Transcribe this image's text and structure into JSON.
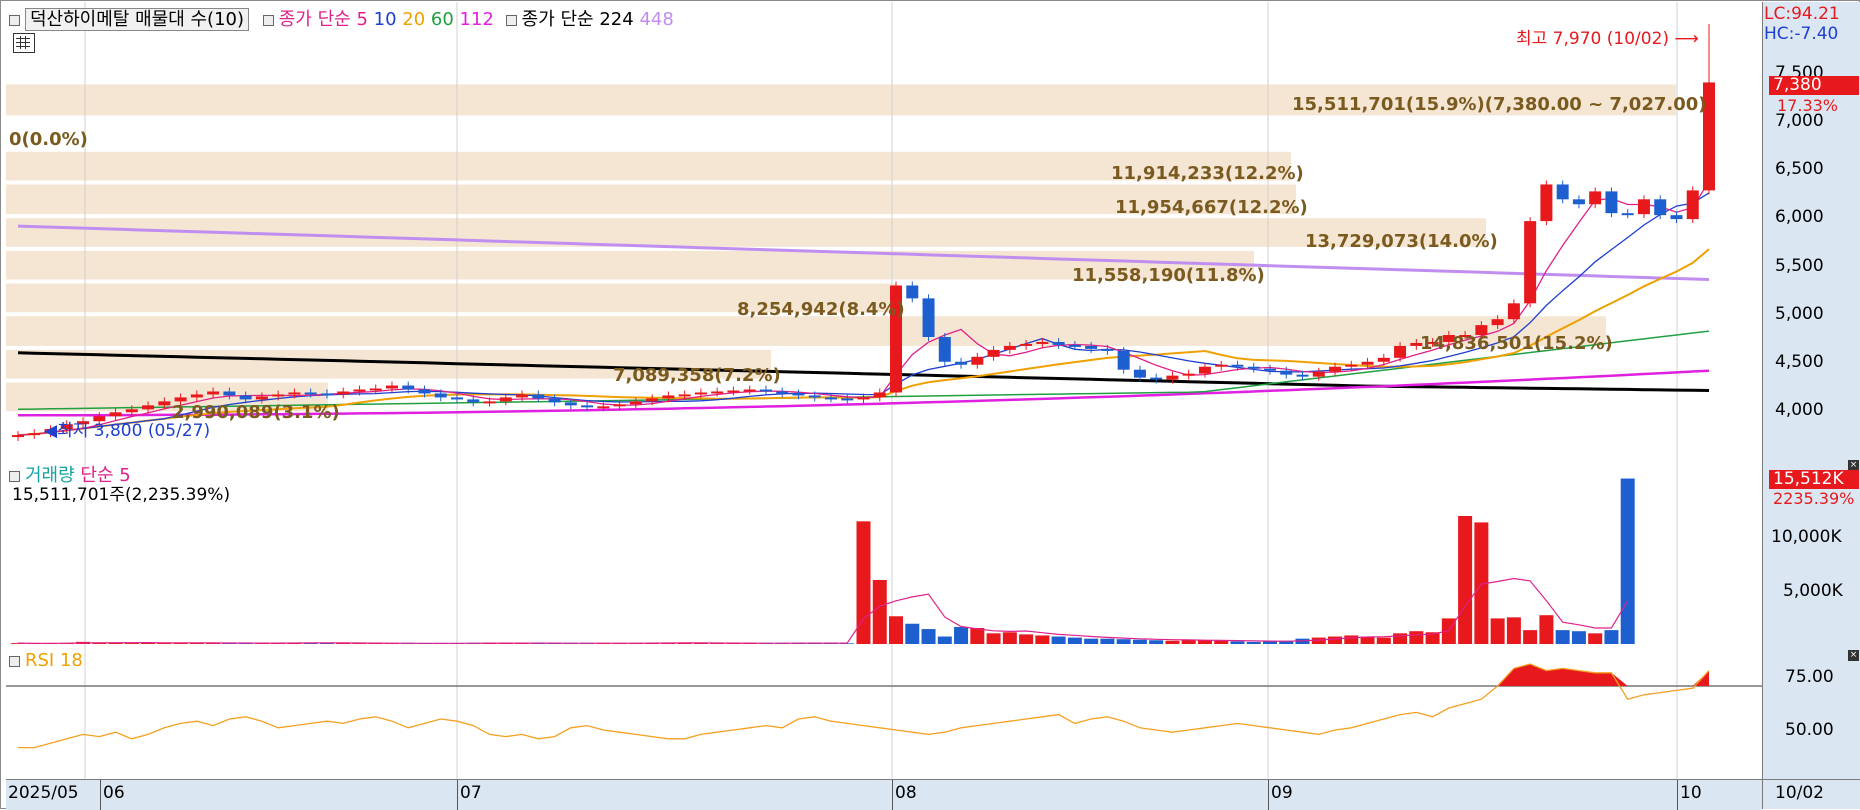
{
  "header": {
    "stock_title": "덕산하이메탈 매물대 수(10)",
    "ma_group1_label": "종가 단순",
    "ma_group1_periods": [
      "5",
      "10",
      "20",
      "60",
      "112"
    ],
    "ma_group2_label": "종가 단순",
    "ma_group2_periods": [
      "224",
      "448"
    ]
  },
  "price_pane": {
    "high_label": "최고 7,970 (10/02)",
    "low_label": "최저 3,800 (05/27)",
    "lc_label": "LC:94.21",
    "hc_label": "HC:-7.40",
    "current_price": "7,380",
    "current_change": "17.33%",
    "y_ticks": [
      "7,500",
      "7,000",
      "6,500",
      "6,000",
      "5,500",
      "5,000",
      "4,500",
      "4,000"
    ],
    "volume_profile": [
      {
        "label": "15,511,701(15.9%)(7,380.00 ~ 7,027.00)"
      },
      {
        "label": "0(0.0%)"
      },
      {
        "label": "11,914,233(12.2%)"
      },
      {
        "label": "11,954,667(12.2%)"
      },
      {
        "label": "13,729,073(14.0%)"
      },
      {
        "label": "11,558,190(11.8%)"
      },
      {
        "label": "8,254,942(8.4%)"
      },
      {
        "label": "14,836,501(15.2%)"
      },
      {
        "label": "7,089,358(7.2%)"
      },
      {
        "label": "2,990,089(3.1%)"
      }
    ]
  },
  "volume_pane": {
    "label": "거래량",
    "ma_label": "단순 5",
    "info": "15,511,701주(2,235.39%)",
    "current_value": "15,512K",
    "current_change": "2235.39%",
    "y_ticks": [
      "10,000K",
      "5,000K"
    ]
  },
  "rsi_pane": {
    "label": "RSI 18",
    "y_ticks": [
      "75.00",
      "50.00"
    ]
  },
  "time_axis": {
    "labels": [
      "2025/05",
      "06",
      "07",
      "08",
      "09",
      "10"
    ],
    "right_label": "10/02"
  },
  "colors": {
    "up": "#e8191c",
    "down": "#1e5fd0",
    "ma5": "#e0218a",
    "ma10": "#1e3fd0",
    "ma20": "#f0a000",
    "ma60": "#20a040",
    "ma112": "#e020e0",
    "ma224": "#000000",
    "ma448": "#c08ef0",
    "band": "#f5e6d3",
    "rsi": "#f5a020"
  },
  "chart_data": [
    {
      "type": "candlestick",
      "title": "덕산하이메탈",
      "ylim": [
        3750,
        7990
      ],
      "x_range": [
        "2025/05",
        "10/02"
      ],
      "high": {
        "value": 7970,
        "date": "10/02"
      },
      "low": {
        "value": 3800,
        "date": "05/27"
      },
      "last_close": 7380,
      "last_change_pct": 17.33,
      "closes": [
        3820,
        3840,
        3880,
        3930,
        3960,
        4010,
        4050,
        4080,
        4120,
        4160,
        4200,
        4230,
        4260,
        4220,
        4180,
        4210,
        4230,
        4250,
        4240,
        4230,
        4260,
        4280,
        4290,
        4320,
        4280,
        4240,
        4200,
        4180,
        4150,
        4160,
        4200,
        4230,
        4190,
        4150,
        4120,
        4100,
        4110,
        4130,
        4160,
        4190,
        4220,
        4230,
        4250,
        4260,
        4270,
        4280,
        4260,
        4240,
        4220,
        4200,
        4190,
        4180,
        4200,
        4250,
        5330,
        5200,
        4810,
        4560,
        4530,
        4610,
        4680,
        4720,
        4740,
        4760,
        4730,
        4720,
        4690,
        4670,
        4480,
        4400,
        4380,
        4420,
        4440,
        4510,
        4530,
        4510,
        4490,
        4470,
        4430,
        4410,
        4460,
        4510,
        4530,
        4560,
        4600,
        4720,
        4750,
        4760,
        4830,
        4830,
        4930,
        4990,
        5150,
        5980,
        6350,
        6200,
        6150,
        6280,
        6060,
        6050,
        6200,
        6040,
        6000,
        6290,
        7380
      ],
      "ma_series": [
        {
          "name": "5",
          "period": 5
        },
        {
          "name": "10",
          "period": 10
        },
        {
          "name": "20",
          "period": 20
        },
        {
          "name": "60",
          "period": 60
        },
        {
          "name": "112",
          "period": 112
        },
        {
          "name": "224",
          "period": 224
        },
        {
          "name": "448",
          "period": 448
        }
      ]
    },
    {
      "type": "bar",
      "title": "거래량",
      "ylim": [
        0,
        16500
      ],
      "unit": "K",
      "values": [
        80,
        60,
        70,
        90,
        200,
        150,
        100,
        90,
        110,
        120,
        130,
        90,
        80,
        70,
        80,
        90,
        100,
        110,
        120,
        90,
        80,
        70,
        80,
        60,
        70,
        60,
        60,
        80,
        100,
        110,
        80,
        70,
        60,
        80,
        90,
        60,
        70,
        80,
        90,
        100,
        110,
        120,
        80,
        70,
        60,
        70,
        80,
        100,
        90,
        80,
        70,
        60,
        11500,
        6000,
        2600,
        1900,
        1400,
        700,
        1600,
        1500,
        1000,
        1100,
        900,
        800,
        700,
        600,
        500,
        500,
        450,
        400,
        350,
        300,
        400,
        350,
        300,
        250,
        200,
        250,
        300,
        500,
        600,
        700,
        800,
        700,
        600,
        1000,
        1200,
        1100,
        2400,
        12000,
        11400,
        2400,
        2500,
        1300,
        2700,
        1300,
        1200,
        1000,
        1300,
        15512
      ]
    },
    {
      "type": "line",
      "title": "RSI 18",
      "ylim": [
        30,
        85
      ],
      "reference": 70,
      "values": [
        42,
        42,
        44,
        46,
        48,
        47,
        49,
        46,
        48,
        51,
        53,
        54,
        52,
        55,
        56,
        54,
        51,
        52,
        53,
        54,
        53,
        55,
        56,
        54,
        51,
        53,
        55,
        54,
        52,
        48,
        47,
        48,
        46,
        47,
        51,
        52,
        50,
        49,
        48,
        47,
        46,
        46,
        48,
        49,
        50,
        51,
        52,
        51,
        55,
        56,
        54,
        53,
        52,
        51,
        50,
        49,
        48,
        49,
        51,
        52,
        53,
        54,
        55,
        56,
        57,
        53,
        55,
        56,
        54,
        51,
        50,
        49,
        50,
        51,
        52,
        53,
        52,
        51,
        50,
        49,
        48,
        50,
        51,
        53,
        55,
        57,
        58,
        56,
        60,
        62,
        64,
        70,
        78,
        80,
        77,
        78,
        77,
        76,
        76,
        64,
        66,
        67,
        68,
        69,
        77
      ]
    }
  ]
}
